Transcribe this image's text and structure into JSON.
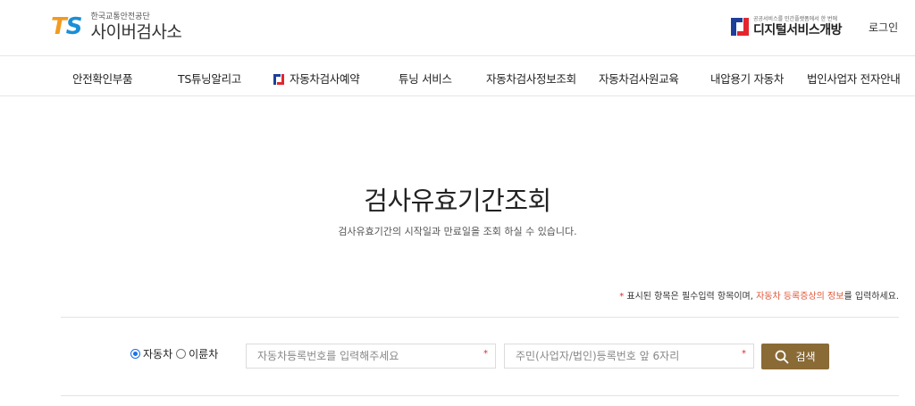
{
  "header": {
    "logo_mark_t": "T",
    "logo_mark_s": "S",
    "logo_sub": "한국교통안전공단",
    "logo_main": "사이버검사소",
    "digital_sub": "공공서비스를 민간플랫폼에서 한 번에",
    "digital_main": "디지털서비스개방",
    "login": "로그인"
  },
  "nav": {
    "items": [
      {
        "label": "안전확인부품"
      },
      {
        "label": "TS튜닝알리고"
      },
      {
        "label": "자동차검사예약"
      },
      {
        "label": "튜닝 서비스"
      },
      {
        "label": "자동차검사정보조회"
      },
      {
        "label": "자동차검사원교육"
      },
      {
        "label": "내압용기 자동차"
      },
      {
        "label": "법인사업자 전자안내"
      }
    ]
  },
  "main": {
    "title": "검사유효기간조회",
    "description": "검사유효기간의 시작일과 만료일을 조회 하실 수 있습니다.",
    "notice": {
      "star": "*",
      "text1": " 표시된 항목은 필수입력 항목이며, ",
      "link": "자동차 등록증상의 정보",
      "text2": "를 입력하세요."
    }
  },
  "form": {
    "radio_car": "자동차",
    "radio_bike": "이륜차",
    "selected": "자동차",
    "plate_placeholder": "자동차등록번호를 입력해주세요",
    "id_placeholder": "주민(사업자/법인)등록번호 앞 6자리",
    "required_mark": "*",
    "search_label": "검색"
  },
  "colors": {
    "brand_orange": "#f39a1e",
    "brand_blue": "#1a8fd6",
    "search_button": "#8a6a35",
    "required": "#e3262e"
  }
}
